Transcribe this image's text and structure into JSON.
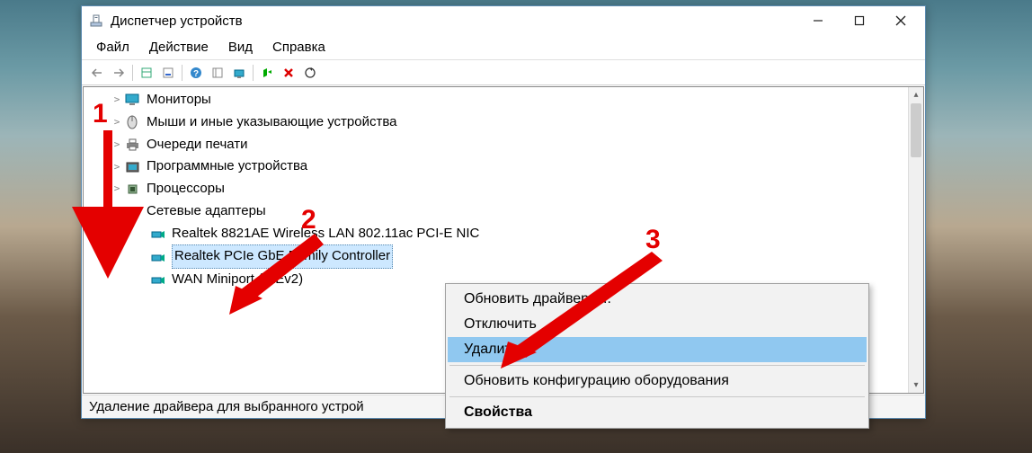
{
  "window": {
    "title": "Диспетчер устройств"
  },
  "menu": {
    "file": "Файл",
    "action": "Действие",
    "view": "Вид",
    "help": "Справка"
  },
  "tree": {
    "monitors": "Мониторы",
    "mice": "Мыши и иные указывающие устройства",
    "printqueues": "Очереди печати",
    "software": "Программные устройства",
    "processors": "Процессоры",
    "netadapters": "Сетевые адаптеры",
    "adapter1": "Realtek 8821AE Wireless LAN 802.11ac PCI-E NIC",
    "adapter2": "Realtek PCIe GbE Family Controller",
    "adapter3": "WAN Miniport (IKEv2)"
  },
  "context_menu": {
    "update": "Обновить драйверы...",
    "disable": "Отключить",
    "remove": "Удалить",
    "scan": "Обновить конфигурацию оборудования",
    "properties": "Свойства"
  },
  "statusbar": {
    "text": "Удаление драйвера для выбранного устрой"
  },
  "annotations": {
    "n1": "1",
    "n2": "2",
    "n3": "3"
  }
}
